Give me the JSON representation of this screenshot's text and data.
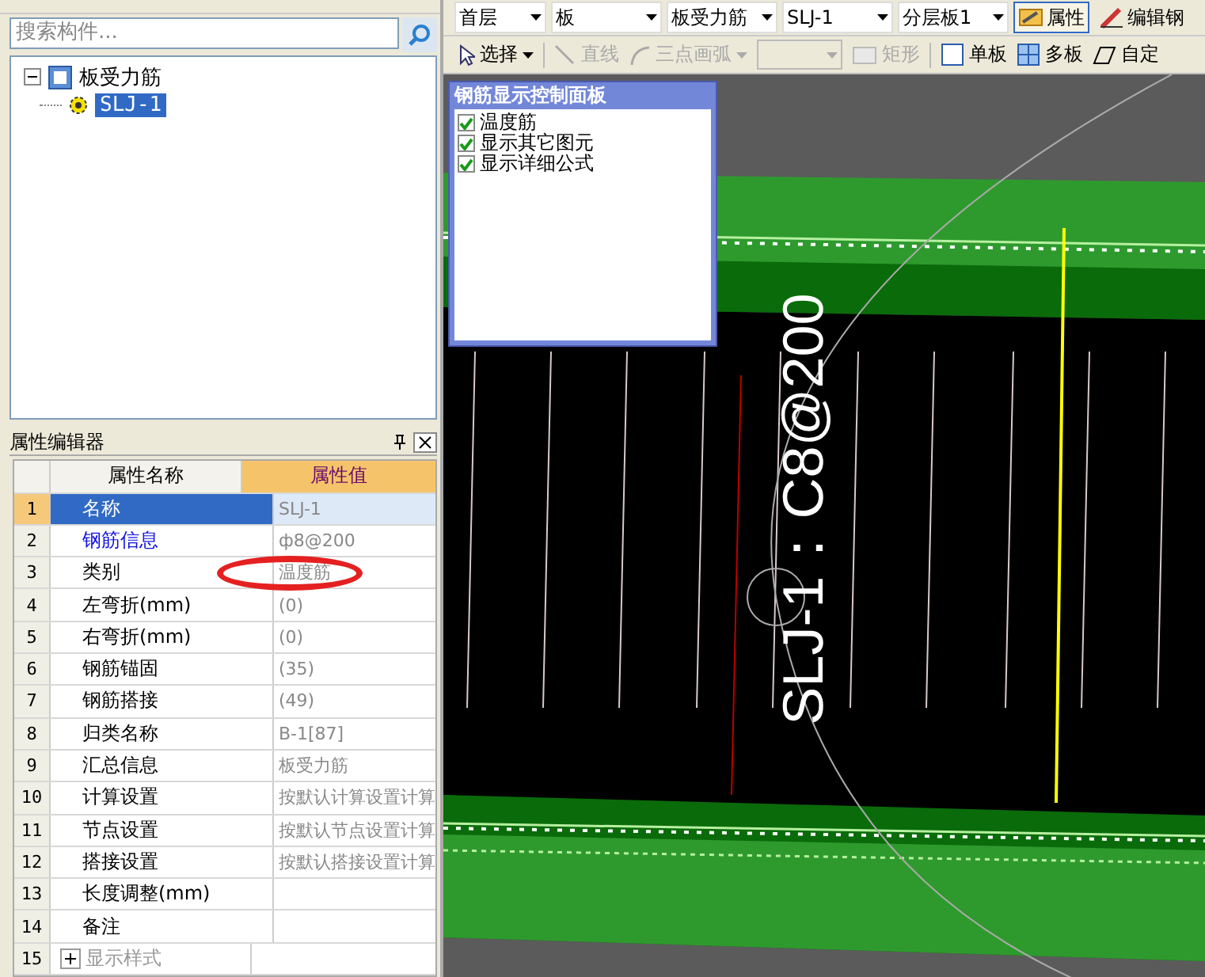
{
  "search": {
    "placeholder": "搜索构件..."
  },
  "tree": [
    {
      "label": "板受力筋",
      "expanded": true,
      "children": [
        {
          "label": "SLJ-1",
          "selected": true
        }
      ]
    }
  ],
  "property_editor": {
    "title": "属性编辑器",
    "columns": [
      "属性名称",
      "属性值"
    ],
    "rows": [
      {
        "index": "1",
        "name": "名称",
        "value": "SLJ-1",
        "selected": true,
        "kind": "plain"
      },
      {
        "index": "2",
        "name": "钢筋信息",
        "value": "ф8@200",
        "selected": false,
        "kind": "link"
      },
      {
        "index": "3",
        "name": "类别",
        "value": "温度筋",
        "selected": false,
        "kind": "plain"
      },
      {
        "index": "4",
        "name": "左弯折(mm)",
        "value": "(0)",
        "selected": false,
        "kind": "plain"
      },
      {
        "index": "5",
        "name": "右弯折(mm)",
        "value": "(0)",
        "selected": false,
        "kind": "plain"
      },
      {
        "index": "6",
        "name": "钢筋锚固",
        "value": "(35)",
        "selected": false,
        "kind": "plain"
      },
      {
        "index": "7",
        "name": "钢筋搭接",
        "value": "(49)",
        "selected": false,
        "kind": "plain"
      },
      {
        "index": "8",
        "name": "归类名称",
        "value": "B-1[87]",
        "selected": false,
        "kind": "plain"
      },
      {
        "index": "9",
        "name": "汇总信息",
        "value": "板受力筋",
        "selected": false,
        "kind": "plain"
      },
      {
        "index": "10",
        "name": "计算设置",
        "value": "按默认计算设置计算",
        "selected": false,
        "kind": "plain"
      },
      {
        "index": "11",
        "name": "节点设置",
        "value": "按默认节点设置计算",
        "selected": false,
        "kind": "plain"
      },
      {
        "index": "12",
        "name": "搭接设置",
        "value": "按默认搭接设置计算",
        "selected": false,
        "kind": "plain"
      },
      {
        "index": "13",
        "name": "长度调整(mm)",
        "value": "",
        "selected": false,
        "kind": "plain"
      },
      {
        "index": "14",
        "name": "备注",
        "value": "",
        "selected": false,
        "kind": "plain"
      },
      {
        "index": "15",
        "name": "显示样式",
        "value": "",
        "selected": false,
        "kind": "group"
      }
    ]
  },
  "toolbar_1": {
    "combos": [
      "首层",
      "板",
      "板受力筋",
      "SLJ-1",
      "分层板1"
    ],
    "buttons": [
      {
        "label": "属性",
        "selected": true
      },
      {
        "label": "编辑钢",
        "selected": false
      }
    ]
  },
  "toolbar_2": [
    {
      "label": "选择",
      "kind": "select",
      "disabled": false
    },
    {
      "label": "直线",
      "kind": "line",
      "disabled": true
    },
    {
      "label": "三点画弧",
      "kind": "arc",
      "disabled": true
    },
    {
      "kind": "combo",
      "disabled": true
    },
    {
      "label": "矩形",
      "kind": "rect",
      "disabled": true
    },
    {
      "label": "单板",
      "kind": "single",
      "disabled": false
    },
    {
      "label": "多板",
      "kind": "multi",
      "disabled": false
    },
    {
      "label": "自定",
      "kind": "custom",
      "disabled": false
    }
  ],
  "control_panel": {
    "title": "钢筋显示控制面板",
    "options": [
      {
        "label": "温度筋",
        "checked": true
      },
      {
        "label": "显示其它图元",
        "checked": true
      },
      {
        "label": "显示详细公式",
        "checked": true
      }
    ]
  },
  "canvas": {
    "rebar_label": "SLJ-1：C8@200"
  }
}
